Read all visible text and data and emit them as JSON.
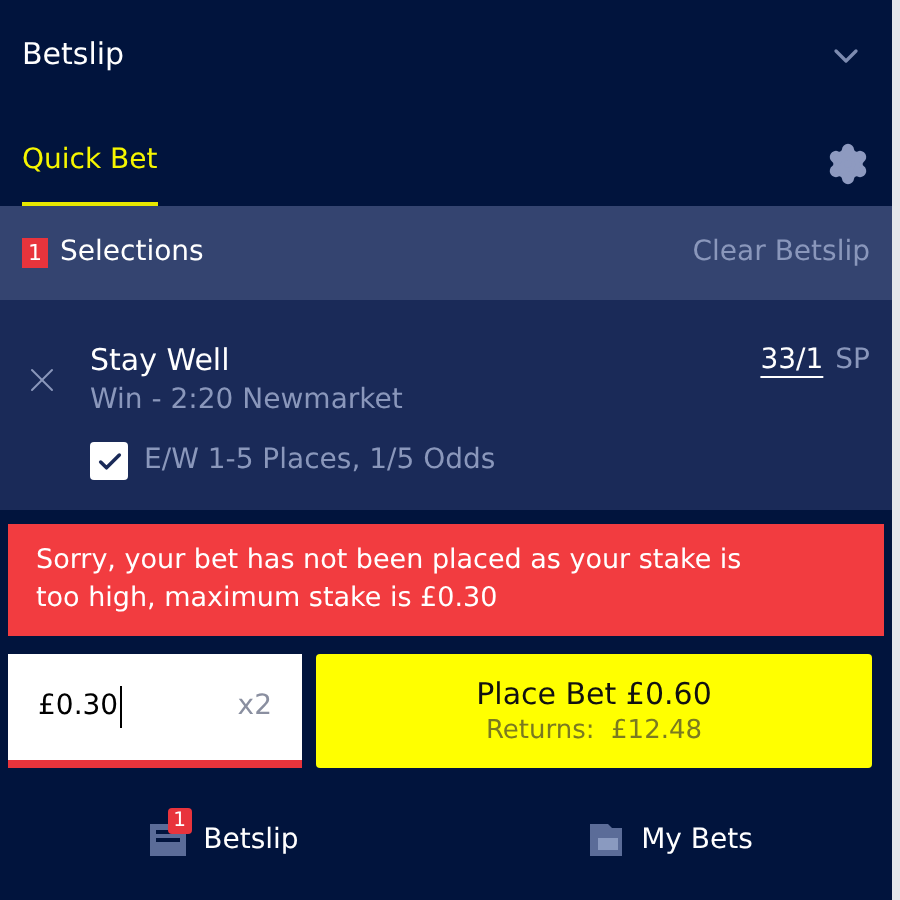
{
  "header": {
    "title": "Betslip"
  },
  "tabs": [
    {
      "label": "Quick Bet",
      "selected": true
    }
  ],
  "selections_bar": {
    "count": "1",
    "label": "Selections",
    "clear": "Clear Betslip"
  },
  "selection": {
    "name": "Stay Well",
    "market": "Win - 2:20 Newmarket",
    "odds": "33/1",
    "price_type": "SP",
    "each_way": {
      "label": "E/W 1-5 Places, 1/5 Odds",
      "checked": true
    }
  },
  "error": "Sorry, your bet has not been placed as your stake is too high, maximum stake is £0.30",
  "stake": {
    "value": "£0.30",
    "multiplier": "x2",
    "invalid": true
  },
  "place_bet": {
    "label": "Place Bet £0.60",
    "returns": "Returns:  £12.48"
  },
  "bottom_nav": [
    {
      "label": "Betslip",
      "badge": "1",
      "kind": "betslip"
    },
    {
      "label": "My Bets",
      "kind": "mybets"
    }
  ]
}
